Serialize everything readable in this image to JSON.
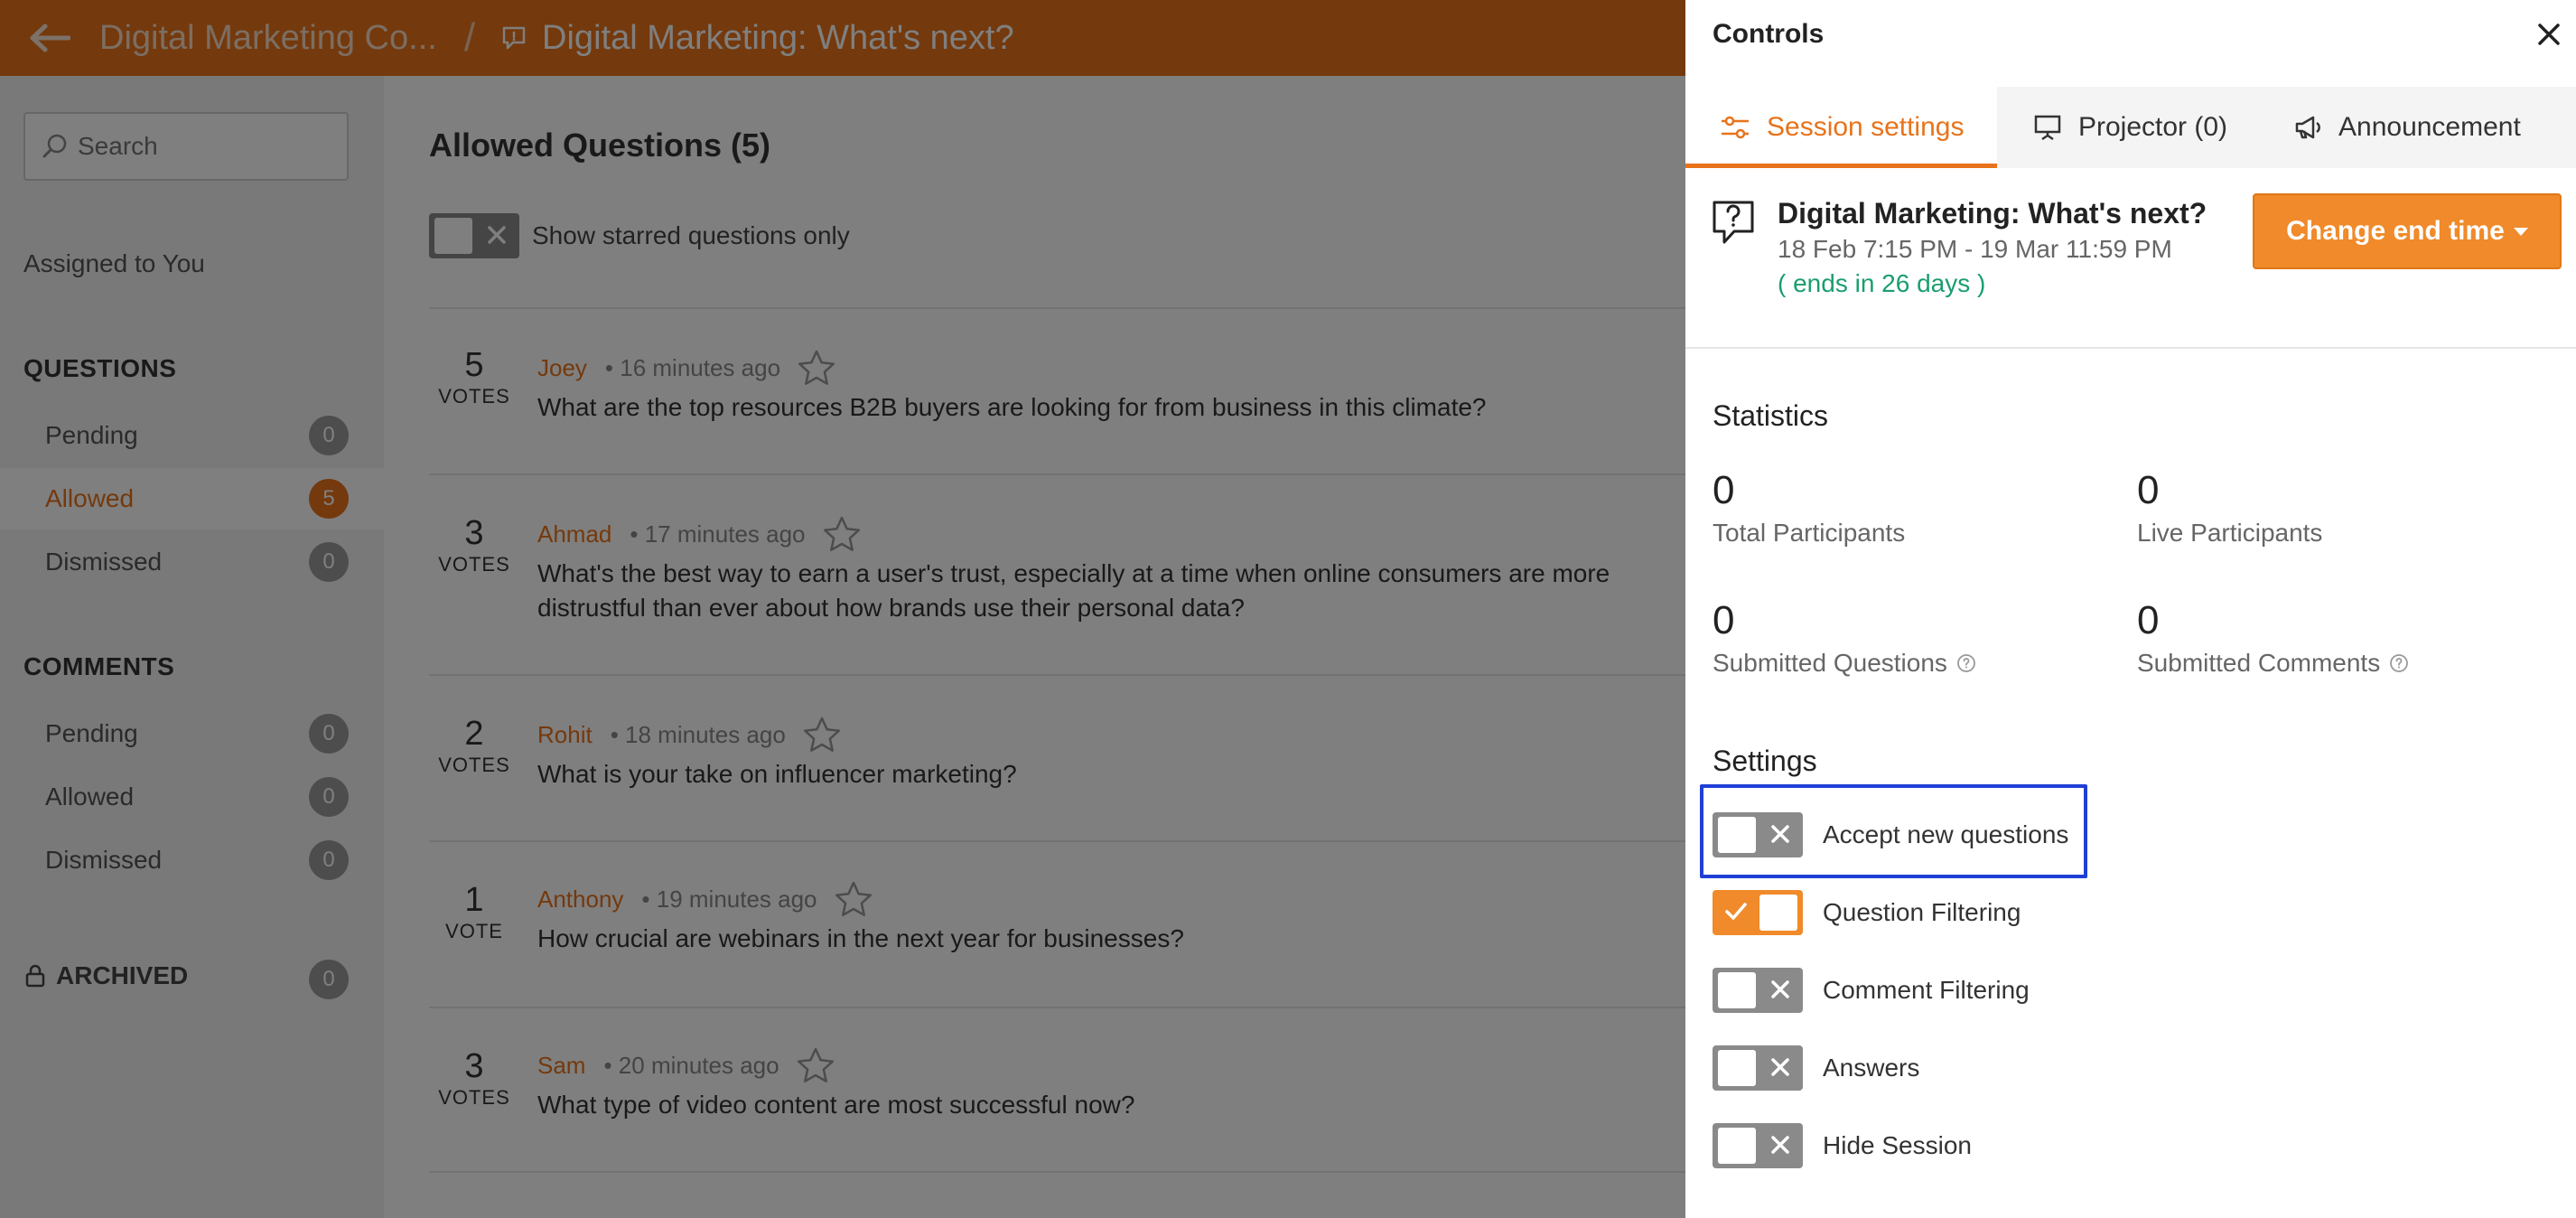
{
  "topbar": {
    "parent_crumb": "Digital Marketing Co...",
    "separator": "/",
    "current_crumb": "Digital Marketing: What's next?"
  },
  "sidebar": {
    "search_placeholder": "Search",
    "assigned": "Assigned to You",
    "questions_heading": "QUESTIONS",
    "questions": [
      {
        "label": "Pending",
        "count": "0"
      },
      {
        "label": "Allowed",
        "count": "5"
      },
      {
        "label": "Dismissed",
        "count": "0"
      }
    ],
    "comments_heading": "COMMENTS",
    "comments": [
      {
        "label": "Pending",
        "count": "0"
      },
      {
        "label": "Allowed",
        "count": "0"
      },
      {
        "label": "Dismissed",
        "count": "0"
      }
    ],
    "archived_label": "ARCHIVED",
    "archived_count": "0"
  },
  "main": {
    "title": "Allowed Questions (5)",
    "starred_toggle_label": "Show starred questions only",
    "questions": [
      {
        "votes": "5",
        "votes_label": "VOTES",
        "author": "Joey",
        "time": "16 minutes ago",
        "text": "What are the top resources B2B buyers are looking for from business in this climate?"
      },
      {
        "votes": "3",
        "votes_label": "VOTES",
        "author": "Ahmad",
        "time": "17 minutes ago",
        "text": "What's the best way to earn a user's trust, especially at a time when online consumers are more distrustful than ever about how brands use their personal data?"
      },
      {
        "votes": "2",
        "votes_label": "VOTES",
        "author": "Rohit",
        "time": "18 minutes ago",
        "text": "What is your take on influencer marketing?"
      },
      {
        "votes": "1",
        "votes_label": "VOTE",
        "author": "Anthony",
        "time": "19 minutes ago",
        "text": "How crucial are webinars in the next year for businesses?"
      },
      {
        "votes": "3",
        "votes_label": "VOTES",
        "author": "Sam",
        "time": "20 minutes ago",
        "text": "What type of video content are most successful now?"
      }
    ]
  },
  "panel": {
    "title": "Controls",
    "tabs": [
      {
        "label": "Session settings",
        "icon": "sliders-icon",
        "active": true
      },
      {
        "label": "Projector (0)",
        "icon": "projector-icon",
        "active": false
      },
      {
        "label": "Announcement",
        "icon": "megaphone-icon",
        "active": false
      }
    ],
    "session": {
      "title": "Digital Marketing: What's next?",
      "dates": "18 Feb 7:15 PM - 19 Mar 11:59 PM",
      "ends": "( ends in 26 days )",
      "end_button": "Change end time"
    },
    "statistics_heading": "Statistics",
    "stats": [
      {
        "value": "0",
        "label": "Total Participants",
        "help": false
      },
      {
        "value": "0",
        "label": "Live Participants",
        "help": false
      },
      {
        "value": "0",
        "label": "Submitted Questions",
        "help": true
      },
      {
        "value": "0",
        "label": "Submitted Comments",
        "help": true
      }
    ],
    "settings_heading": "Settings",
    "settings": [
      {
        "label": "Accept new questions",
        "on": false
      },
      {
        "label": "Question Filtering",
        "on": true
      },
      {
        "label": "Comment Filtering",
        "on": false
      },
      {
        "label": "Answers",
        "on": false
      },
      {
        "label": "Hide Session",
        "on": false
      }
    ]
  },
  "colors": {
    "brand": "#e8731a",
    "button": "#f08a2a",
    "success": "#1a9e6e",
    "highlight": "#1f3fd6"
  }
}
